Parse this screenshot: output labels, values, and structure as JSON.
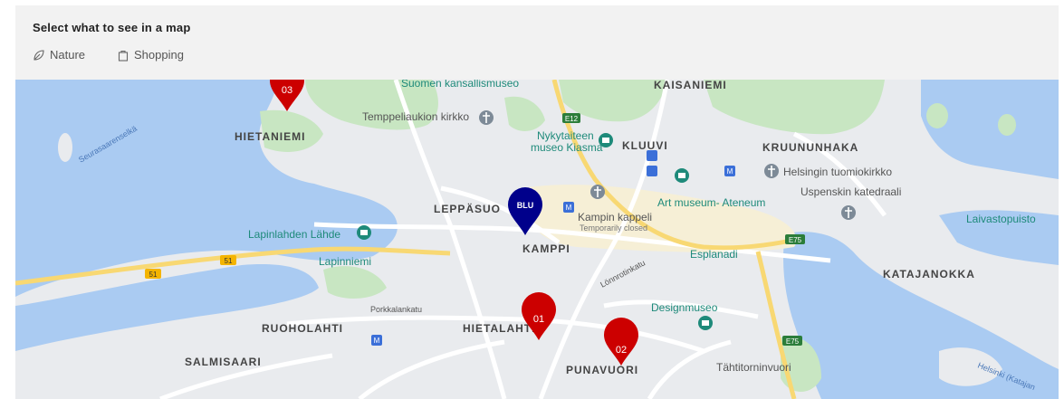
{
  "panel": {
    "title": "Select what to see in a map",
    "filters": [
      {
        "label": "Nature",
        "icon": "leaf-icon"
      },
      {
        "label": "Shopping",
        "icon": "shopping-bag-icon"
      }
    ]
  },
  "map": {
    "districts": {
      "kaisaniemi": "KAISANIEMI",
      "hietaniemi": "HIETANIEMI",
      "kluuvi": "KLUUVI",
      "kruununhaka": "KRUUNUNHAKA",
      "leppasuo": "LEPPÄSUO",
      "kamppi": "KAMPPI",
      "katajanokka": "KATAJANOKKA",
      "ruoholahti": "RUOHOLAHTI",
      "hietalahti": "HIETALAHTI",
      "salmisaari": "SALMISAARI",
      "punavuori": "PUNAVUORI"
    },
    "places": {
      "suomen_kansallismuseo": "Suomen kansallismuseo",
      "temppeliaukion": "Temppeliaukion kirkko",
      "kiasma_line1": "Nykytaiteen",
      "kiasma_line2": "museo Kiasma",
      "tuomiokirkko": "Helsingin tuomiokirkko",
      "uspenskin": "Uspenskin katedraali",
      "ateneum": "Art museum- Ateneum",
      "laivastopuisto": "Laivastopuisto",
      "lapinlahden": "Lapinlahden Lähde",
      "lapinniemi": "Lapinniemi",
      "kampin_kappeli": "Kampin kappeli",
      "temporarily_closed": "Temporarily closed",
      "esplanadi": "Esplanadi",
      "designmuseo": "Designmuseo",
      "tahtitorninvuori": "Tähtitorninvuori"
    },
    "water_labels": {
      "seurasaarenselka": "Seurasaarenselkä",
      "helsinki_katajanokka": "Helsinki (Katajan"
    },
    "streets": {
      "porkkalankatu": "Porkkalankatu",
      "lonnrotinkatu": "Lönnrotinkatu"
    },
    "road_shields": {
      "e12": "E12",
      "e75_a": "E75",
      "e75_b": "E75",
      "r51_a": "51",
      "r51_b": "51"
    },
    "markers": {
      "hotel": "BLU",
      "m01": "01",
      "m02": "02",
      "m03": "03"
    },
    "colors": {
      "water": "#aacbf2",
      "park": "#c8e6c2",
      "land": "#e9ebee",
      "road": "#ffffff",
      "highway": "#f8d873",
      "marker_red": "#cc0000",
      "marker_blue": "#00008b",
      "district_label": "#444444",
      "poi_green": "#1e8a7a"
    }
  }
}
